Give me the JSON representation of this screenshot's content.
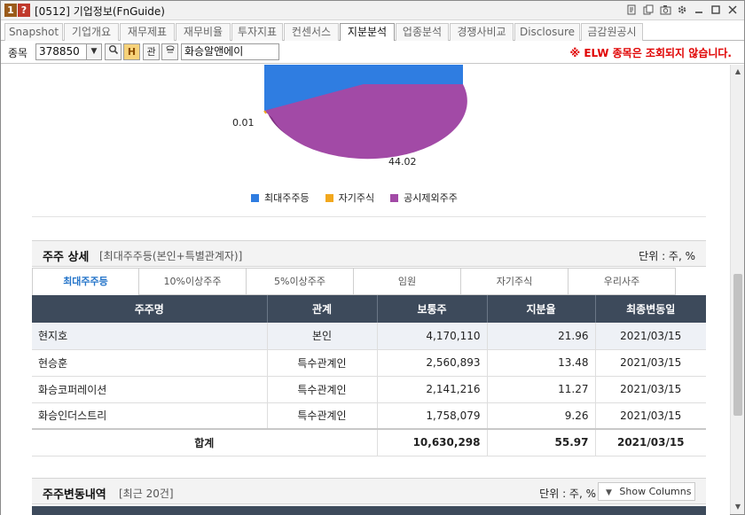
{
  "window": {
    "num_badge": "1",
    "help_badge": "?",
    "title": "[0512] 기업정보(FnGuide)",
    "icons": [
      "bookmark-icon",
      "copy-icon",
      "camera-icon",
      "gear-icon",
      "minimize-icon",
      "maximize-icon",
      "close-icon"
    ]
  },
  "tabs": [
    {
      "label": "Snapshot",
      "active": false
    },
    {
      "label": "기업개요",
      "active": false
    },
    {
      "label": "재무제표",
      "active": false
    },
    {
      "label": "재무비율",
      "active": false
    },
    {
      "label": "투자지표",
      "active": false
    },
    {
      "label": "컨센서스",
      "active": false
    },
    {
      "label": "지분분석",
      "active": true
    },
    {
      "label": "업종분석",
      "active": false
    },
    {
      "label": "경쟁사비교",
      "active": false
    },
    {
      "label": "Disclosure",
      "active": false
    },
    {
      "label": "금감원공시",
      "active": false
    }
  ],
  "toolbar": {
    "label": "종목",
    "code": "378850",
    "btn_search": "🔍",
    "btn_fav": "H",
    "btn_rel": "관",
    "btn_ext": "⇩",
    "company_name": "화승알앤에이",
    "notice": "※ ELW 종목은 조회되지 않습니다."
  },
  "pie": {
    "label_small": "0.01",
    "label_big": "44.02",
    "colors": {
      "major": "#2f7de1",
      "treasury": "#f2a81d",
      "nonpublic": "#a24aa6"
    },
    "values": {
      "major": 55.97,
      "treasury": 0.01,
      "nonpublic": 44.02
    },
    "legend": [
      {
        "label": "최대주주등",
        "color": "#2f7de1"
      },
      {
        "label": "자기주식",
        "color": "#f2a81d"
      },
      {
        "label": "공시제외주주",
        "color": "#a24aa6"
      }
    ]
  },
  "detail": {
    "title": "주주 상세",
    "subtitle": "[최대주주등(본인+특별관계자)]",
    "unit": "단위 : 주, %",
    "subtabs": [
      {
        "label": "최대주주등",
        "active": true
      },
      {
        "label": "10%이상주주",
        "active": false
      },
      {
        "label": "5%이상주주",
        "active": false
      },
      {
        "label": "임원",
        "active": false
      },
      {
        "label": "자기주식",
        "active": false
      },
      {
        "label": "우리사주",
        "active": false
      }
    ],
    "columns": [
      "주주명",
      "관계",
      "보통주",
      "지분율",
      "최종변동일"
    ],
    "rows": [
      {
        "name": "현지호",
        "relation": "본인",
        "shares": "4,170,110",
        "ratio": "21.96",
        "date": "2021/03/15"
      },
      {
        "name": "현승훈",
        "relation": "특수관계인",
        "shares": "2,560,893",
        "ratio": "13.48",
        "date": "2021/03/15"
      },
      {
        "name": "화승코퍼레이션",
        "relation": "특수관계인",
        "shares": "2,141,216",
        "ratio": "11.27",
        "date": "2021/03/15"
      },
      {
        "name": "화승인더스트리",
        "relation": "특수관계인",
        "shares": "1,758,079",
        "ratio": "9.26",
        "date": "2021/03/15"
      }
    ],
    "total": {
      "label": "합계",
      "shares": "10,630,298",
      "ratio": "55.97",
      "date": "2021/03/15"
    }
  },
  "changes": {
    "title": "주주변동내역",
    "subtitle": "[최근 20건]",
    "unit": "단위 : 주, %",
    "show_columns": "Show Columns"
  }
}
